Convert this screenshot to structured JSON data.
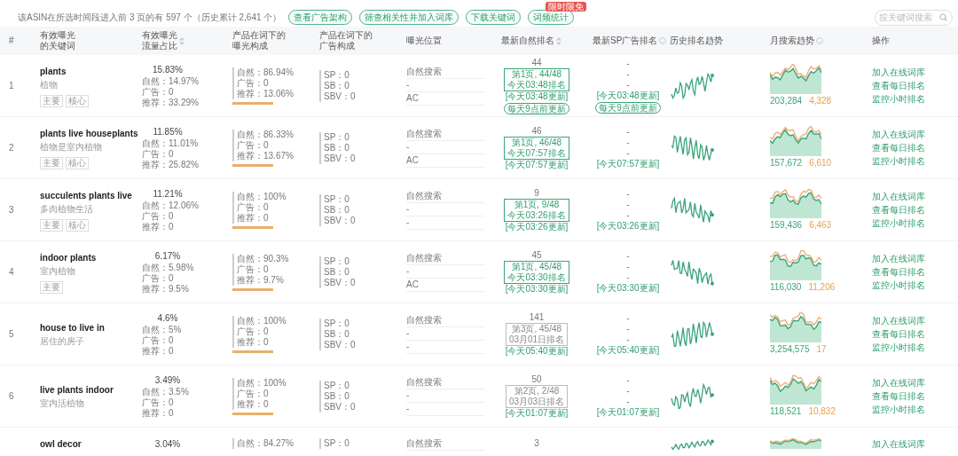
{
  "summary": "该ASIN在所选时间段进入前 3 页的有 597 个（历史累计 2,641 个）",
  "toolbar": [
    {
      "label": "查看广告架构"
    },
    {
      "label": "筛查相关性并加入词库"
    },
    {
      "label": "下载关键词"
    },
    {
      "label": "词频统计",
      "badge": "限时限免"
    }
  ],
  "search": {
    "placeholder": "按关键词搜索"
  },
  "columns": [
    {
      "label": "#"
    },
    {
      "label": "有效曝光的关键词"
    },
    {
      "label": "有效曝光流量占比"
    },
    {
      "label": "产品在词下的曝光构成"
    },
    {
      "label": "产品在词下的广告构成"
    },
    {
      "label": "曝光位置"
    },
    {
      "label": "最新自然排名"
    },
    {
      "label": "最新SP广告排名"
    },
    {
      "label": "历史排名趋势"
    },
    {
      "label": "月搜索趋势"
    },
    {
      "label": "操作"
    }
  ],
  "rows": [
    {
      "index": "1",
      "keyword": "plants",
      "translation": "植物",
      "tags": [
        "主要",
        "核心"
      ],
      "flow_total": "15.83%",
      "flow": [
        "自然：14.97%",
        "广告：0",
        "推荐：33.29%"
      ],
      "composition": [
        "自然：86.94%",
        "广告：0",
        "推荐：13.06%"
      ],
      "ads": [
        "SP：0",
        "SB：0",
        "SBV：0"
      ],
      "positions": [
        "自然搜索",
        "-",
        "AC"
      ],
      "rank": {
        "value": "44",
        "page": "第1页, 44/48",
        "time": "今天03:48排名",
        "current": true,
        "updated": "[今天03:48更新]",
        "note": "每天9点前更新"
      },
      "sp_rank": {
        "values": [
          "-",
          "-",
          "-"
        ],
        "updated": "[今天03:48更新]",
        "note": "每天9点前更新"
      },
      "volume": "203,284",
      "count": "4,328",
      "actions": [
        "加入在线词库",
        "查看每日排名",
        "监控小时排名"
      ]
    },
    {
      "index": "2",
      "keyword": "plants live houseplants",
      "translation": "植物是室内植物",
      "tags": [
        "主要",
        "核心"
      ],
      "flow_total": "11.85%",
      "flow": [
        "自然：11.01%",
        "广告：0",
        "推荐：25.82%"
      ],
      "composition": [
        "自然：86.33%",
        "广告：0",
        "推荐：13.67%"
      ],
      "ads": [
        "SP：0",
        "SB：0",
        "SBV：0"
      ],
      "positions": [
        "自然搜索",
        "-",
        "AC"
      ],
      "rank": {
        "value": "46",
        "page": "第1页, 46/48",
        "time": "今天07:57排名",
        "current": true,
        "updated": "[今天07:57更新]"
      },
      "sp_rank": {
        "values": [
          "-",
          "-",
          "-"
        ],
        "updated": "[今天07:57更新]"
      },
      "volume": "157,672",
      "count": "6,610",
      "actions": [
        "加入在线词库",
        "查看每日排名",
        "监控小时排名"
      ]
    },
    {
      "index": "3",
      "keyword": "succulents plants live",
      "translation": "多肉植物生活",
      "tags": [
        "主要",
        "核心"
      ],
      "flow_total": "11.21%",
      "flow": [
        "自然：12.06%",
        "广告：0",
        "推荐：0"
      ],
      "composition": [
        "自然：100%",
        "广告：0",
        "推荐：0"
      ],
      "ads": [
        "SP：0",
        "SB：0",
        "SBV：0"
      ],
      "positions": [
        "自然搜索",
        "-",
        "-"
      ],
      "rank": {
        "value": "9",
        "page": "第1页, 9/48",
        "time": "今天03:26排名",
        "current": true,
        "updated": "[今天03:26更新]"
      },
      "sp_rank": {
        "values": [
          "-",
          "-",
          "-"
        ],
        "updated": "[今天03:26更新]"
      },
      "volume": "159,436",
      "count": "6,463",
      "actions": [
        "加入在线词库",
        "查看每日排名",
        "监控小时排名"
      ]
    },
    {
      "index": "4",
      "keyword": "indoor plants",
      "translation": "室内植物",
      "tags": [
        "主要"
      ],
      "flow_total": "6.17%",
      "flow": [
        "自然：5.98%",
        "广告：0",
        "推荐：9.5%"
      ],
      "composition": [
        "自然：90.3%",
        "广告：0",
        "推荐：9.7%"
      ],
      "ads": [
        "SP：0",
        "SB：0",
        "SBV：0"
      ],
      "positions": [
        "自然搜索",
        "-",
        "AC"
      ],
      "rank": {
        "value": "45",
        "page": "第1页, 45/48",
        "time": "今天03:30排名",
        "current": true,
        "updated": "[今天03:30更新]"
      },
      "sp_rank": {
        "values": [
          "-",
          "-",
          "-"
        ],
        "updated": "[今天03:30更新]"
      },
      "volume": "116,030",
      "count": "11,206",
      "actions": [
        "加入在线词库",
        "查看每日排名",
        "监控小时排名"
      ]
    },
    {
      "index": "5",
      "keyword": "house to live in",
      "translation": "居住的房子",
      "flow_total": "4.6%",
      "flow": [
        "自然：5%",
        "广告：0",
        "推荐：0"
      ],
      "composition": [
        "自然：100%",
        "广告：0",
        "推荐：0"
      ],
      "ads": [
        "SP：0",
        "SB：0",
        "SBV：0"
      ],
      "positions": [
        "自然搜索",
        "-",
        "-"
      ],
      "rank": {
        "value": "141",
        "page": "第3页, 45/48",
        "time": "03月01日排名",
        "current": false,
        "updated": "[今天05:40更新]"
      },
      "sp_rank": {
        "values": [
          "-",
          "-",
          "-"
        ],
        "updated": "[今天05:40更新]"
      },
      "volume": "3,254,575",
      "count": "17",
      "actions": [
        "加入在线词库",
        "查看每日排名",
        "监控小时排名"
      ]
    },
    {
      "index": "6",
      "keyword": "live plants indoor",
      "translation": "室内活植物",
      "flow_total": "3.49%",
      "flow": [
        "自然：3.5%",
        "广告：0",
        "推荐：0"
      ],
      "composition": [
        "自然：100%",
        "广告：0",
        "推荐：0"
      ],
      "ads": [
        "SP：0",
        "SB：0",
        "SBV：0"
      ],
      "positions": [
        "自然搜索",
        "-",
        "-"
      ],
      "rank": {
        "value": "50",
        "page": "第2页, 2/48",
        "time": "03月03日排名",
        "current": false,
        "updated": "[今天01:07更新]"
      },
      "sp_rank": {
        "values": [
          "-",
          "-",
          "-"
        ],
        "updated": "[今天01:07更新]"
      },
      "volume": "118,521",
      "count": "10,832",
      "actions": [
        "加入在线词库",
        "查看每日排名",
        "监控小时排名"
      ]
    },
    {
      "keyword": "owl decor",
      "flow_total": "3.04%",
      "composition": [
        "自然：84.27%"
      ],
      "ads": [
        "SP：0"
      ],
      "positions": [
        "自然搜索"
      ],
      "rank": {
        "value": "3"
      },
      "actions": [
        "加入在线词库"
      ]
    }
  ]
}
